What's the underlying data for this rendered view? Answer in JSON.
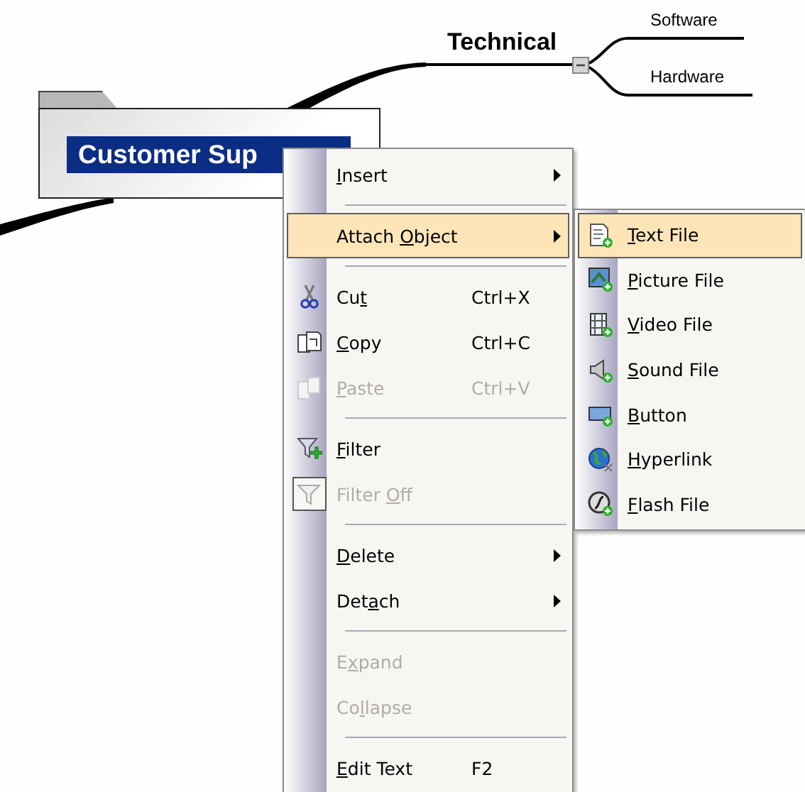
{
  "mind_map": {
    "central_topic": {
      "label": "Customer Sup",
      "selected": true
    },
    "topics": [
      {
        "label": "Technical",
        "expanded": true,
        "children": [
          {
            "label": "Software"
          },
          {
            "label": "Hardware"
          }
        ]
      }
    ]
  },
  "context_menu": {
    "items": [
      {
        "kind": "item",
        "label": {
          "key": "I",
          "post": "nsert"
        },
        "submenu": true,
        "selected": false,
        "disabled": false,
        "checked": false
      },
      {
        "kind": "separator"
      },
      {
        "kind": "item",
        "label": {
          "pre": "Attach ",
          "key": "O",
          "post": "bject"
        },
        "submenu": true,
        "selected": true,
        "disabled": false,
        "checked": false
      },
      {
        "kind": "separator"
      },
      {
        "kind": "item",
        "label": {
          "pre": "Cu",
          "key": "t"
        },
        "shortcut": "Ctrl+X",
        "submenu": false,
        "selected": false,
        "disabled": false,
        "checked": false
      },
      {
        "kind": "item",
        "label": {
          "key": "C",
          "post": "opy"
        },
        "shortcut": "Ctrl+C",
        "submenu": false,
        "selected": false,
        "disabled": false,
        "checked": false
      },
      {
        "kind": "item",
        "label": {
          "key": "P",
          "post": "aste"
        },
        "shortcut": "Ctrl+V",
        "submenu": false,
        "selected": false,
        "disabled": true,
        "checked": false
      },
      {
        "kind": "separator"
      },
      {
        "kind": "item",
        "label": {
          "key": "F",
          "post": "ilter"
        },
        "submenu": false,
        "selected": false,
        "disabled": false,
        "checked": false
      },
      {
        "kind": "item",
        "label": {
          "pre": "Filter ",
          "key": "O",
          "post": "ff"
        },
        "submenu": false,
        "selected": false,
        "disabled": true,
        "checked": true
      },
      {
        "kind": "separator"
      },
      {
        "kind": "item",
        "label": {
          "key": "D",
          "post": "elete"
        },
        "submenu": true,
        "selected": false,
        "disabled": false,
        "checked": false
      },
      {
        "kind": "item",
        "label": {
          "pre": "Det",
          "key": "a",
          "post": "ch"
        },
        "submenu": true,
        "selected": false,
        "disabled": false,
        "checked": false
      },
      {
        "kind": "separator"
      },
      {
        "kind": "item",
        "label": {
          "pre": "E",
          "key": "x",
          "post": "pand"
        },
        "submenu": false,
        "selected": false,
        "disabled": true,
        "checked": false
      },
      {
        "kind": "item",
        "label": {
          "pre": "Co",
          "key": "l",
          "post": "lapse"
        },
        "submenu": false,
        "selected": false,
        "disabled": true,
        "checked": false
      },
      {
        "kind": "separator"
      },
      {
        "kind": "item",
        "label": {
          "key": "E",
          "post": "dit Text"
        },
        "shortcut": "F2",
        "submenu": false,
        "selected": false,
        "disabled": false,
        "checked": false
      }
    ]
  },
  "submenu": {
    "items": [
      {
        "label": {
          "key": "T",
          "post": "ext File"
        },
        "selected": true
      },
      {
        "label": {
          "key": "P",
          "post": "icture File"
        },
        "selected": false
      },
      {
        "label": {
          "key": "V",
          "post": "ideo File"
        },
        "selected": false
      },
      {
        "label": {
          "key": "S",
          "post": "ound File"
        },
        "selected": false
      },
      {
        "label": {
          "key": "B",
          "post": "utton"
        },
        "selected": false
      },
      {
        "label": {
          "key": "H",
          "post": "yperlink"
        },
        "selected": false
      },
      {
        "label": {
          "key": "F",
          "post": "lash File"
        },
        "selected": false
      }
    ]
  }
}
